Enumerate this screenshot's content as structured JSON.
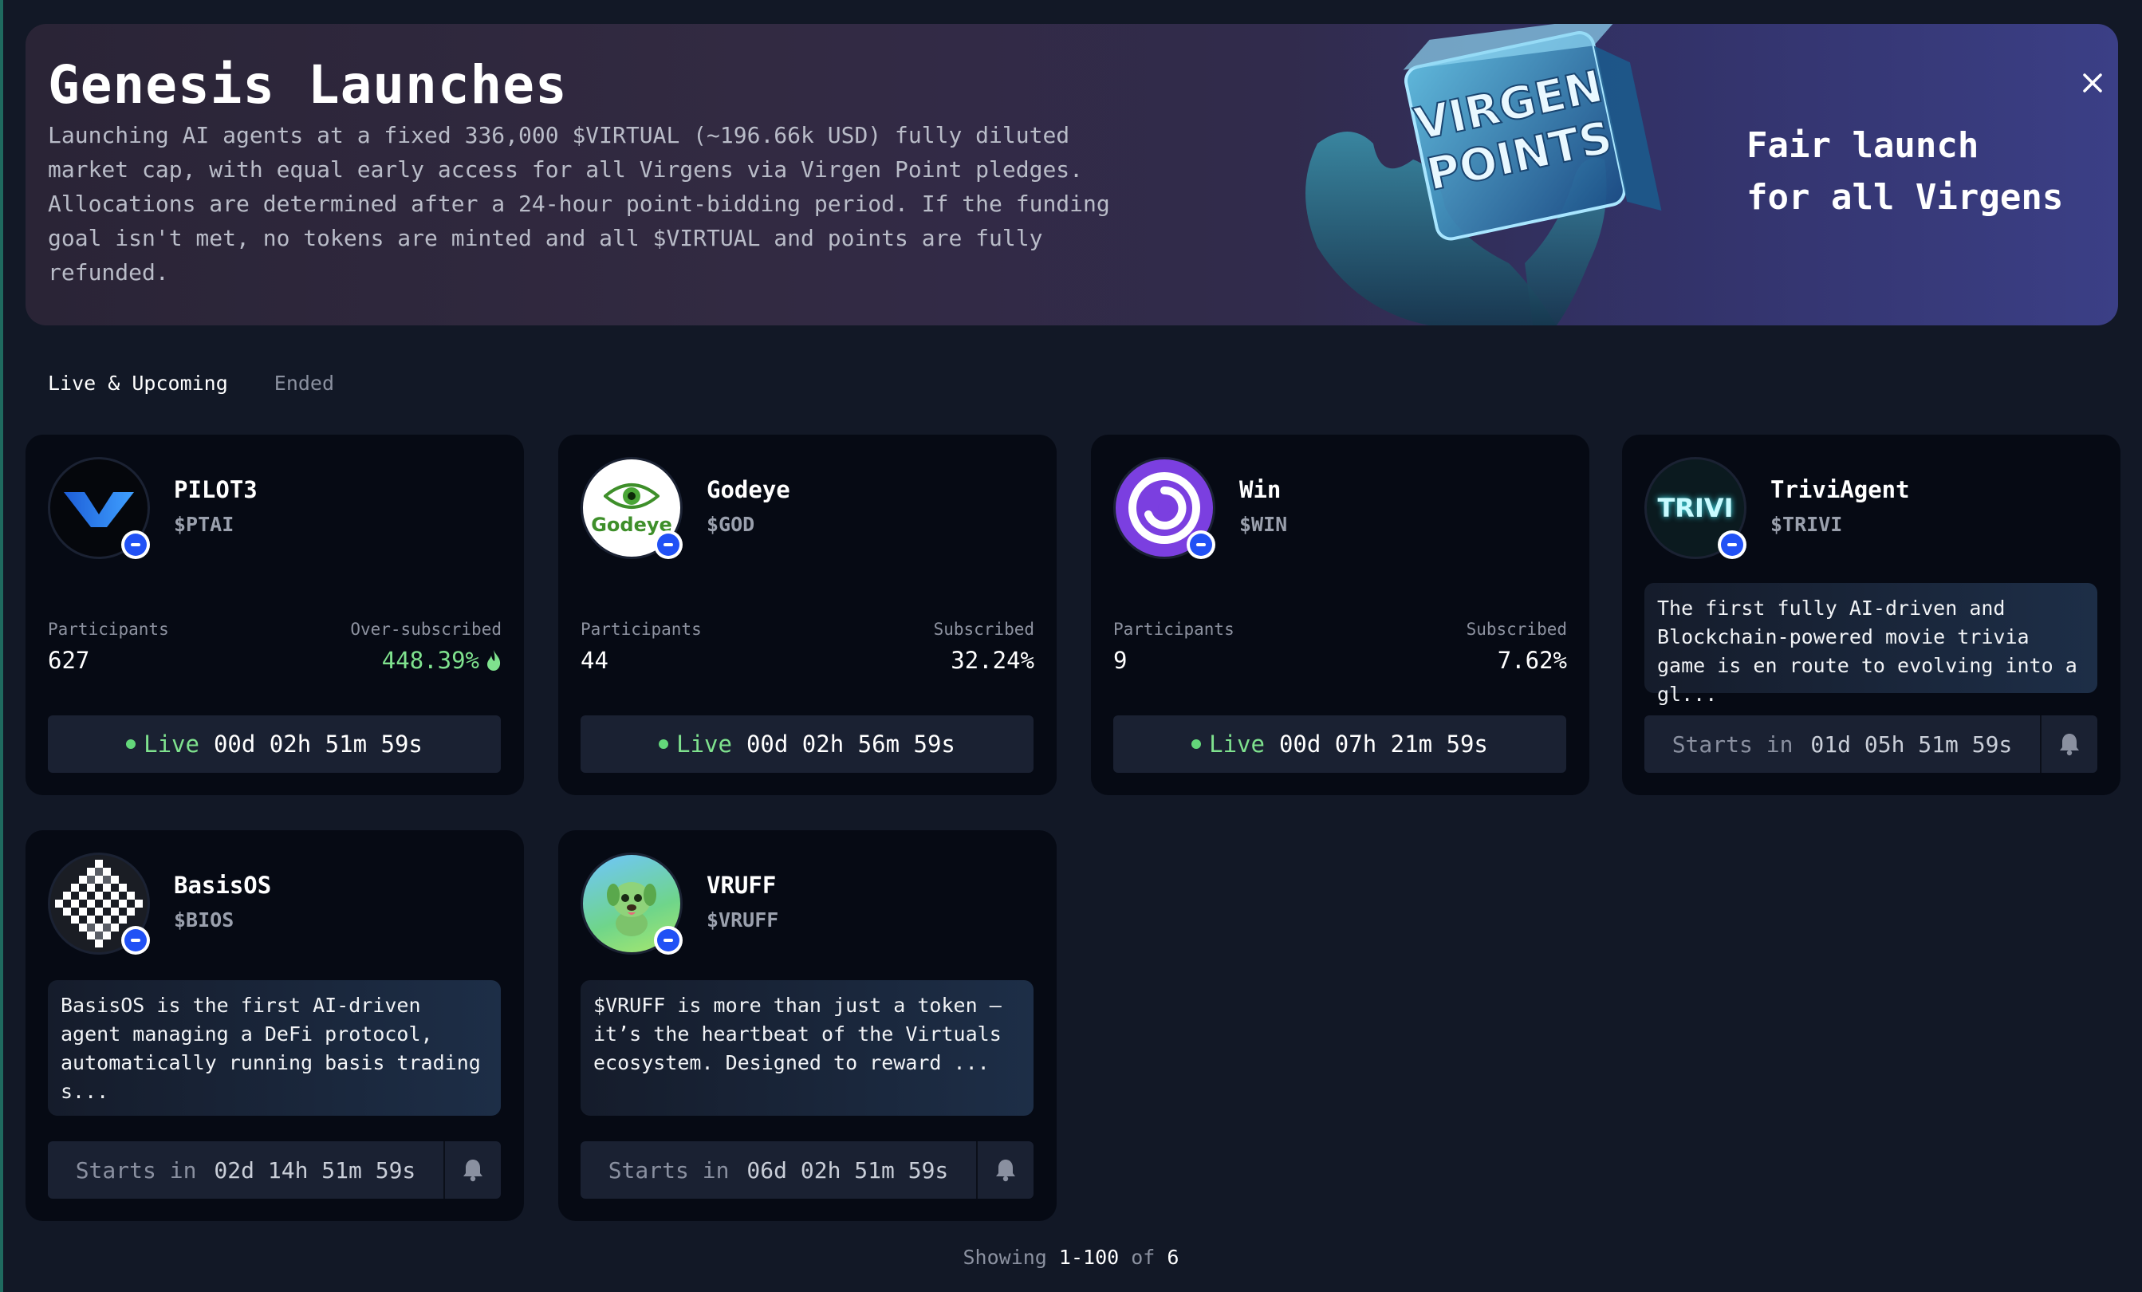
{
  "banner": {
    "title": "Genesis Launches",
    "description": "Launching AI agents at a fixed 336,000 $VIRTUAL (~196.66k USD) fully diluted market cap, with equal early access for all Virgens via Virgen Point pledges. Allocations are determined after a 24-hour point-bidding period. If the funding goal isn't met, no tokens are minted and all $VIRTUAL and points are fully refunded.",
    "art_text": [
      "VIRGEN",
      "POINTS"
    ],
    "tagline": "Fair launch\nfor all Virgens",
    "close_icon": "close-icon"
  },
  "tabs": [
    {
      "label": "Live & Upcoming",
      "active": true
    },
    {
      "label": "Ended",
      "active": false
    }
  ],
  "cards": [
    {
      "name": "PILOT3",
      "ticker": "$PTAI",
      "participants_label": "Participants",
      "participants": "627",
      "sub_label": "Over-subscribed",
      "sub_value": "448.39%",
      "status": "Live",
      "countdown": "00d 02h 51m 59s"
    },
    {
      "name": "Godeye",
      "ticker": "$GOD",
      "logo_text": "Godeye",
      "participants_label": "Participants",
      "participants": "44",
      "sub_label": "Subscribed",
      "sub_value": "32.24%",
      "status": "Live",
      "countdown": "00d 02h 56m 59s"
    },
    {
      "name": "Win",
      "ticker": "$WIN",
      "participants_label": "Participants",
      "participants": "9",
      "sub_label": "Subscribed",
      "sub_value": "7.62%",
      "status": "Live",
      "countdown": "00d 07h 21m 59s"
    },
    {
      "name": "TriviAgent",
      "ticker": "$TRIVI",
      "logo_text": "TRIVI",
      "description": "The first fully AI-driven and Blockchain-powered movie trivia game is en route to evolving into a gl...",
      "starts_label": "Starts in",
      "countdown": "01d 05h 51m 59s"
    },
    {
      "name": "BasisOS",
      "ticker": "$BIOS",
      "description": "BasisOS is the first AI-driven agent managing a DeFi protocol, automatically running basis trading s...",
      "starts_label": "Starts in",
      "countdown": "02d 14h 51m 59s"
    },
    {
      "name": "VRUFF",
      "ticker": "$VRUFF",
      "description": "$VRUFF is more than just a token – it’s the heartbeat of the Virtuals ecosystem. Designed to reward ...",
      "starts_label": "Starts in",
      "countdown": "06d 02h 51m 59s"
    }
  ],
  "footer": {
    "prefix": "Showing",
    "range": "1-100",
    "of": "of",
    "total": "6"
  },
  "colors": {
    "live_green": "#7fe28e",
    "chain_blue": "#2151f5",
    "card_bg": "#060a14",
    "page_bg": "#121826"
  }
}
